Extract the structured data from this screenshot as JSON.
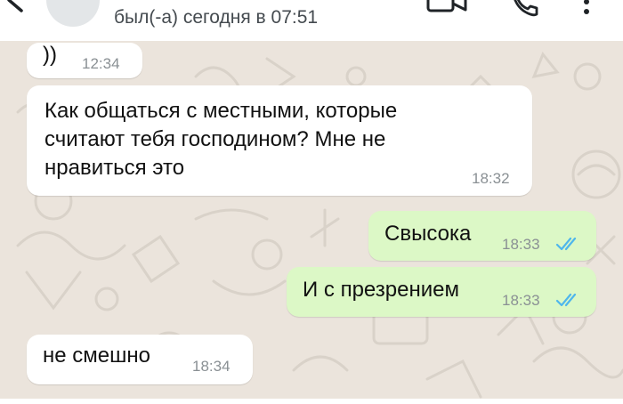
{
  "header": {
    "status": "был(-а) сегодня в 07:51"
  },
  "icons": {
    "back": "arrow-left-icon",
    "video": "video-camera-icon",
    "call": "phone-icon",
    "menu": "more-vertical-icon"
  },
  "colors": {
    "incoming_bubble": "#ffffff",
    "outgoing_bubble": "#dcf8c6",
    "read_ticks": "#4fb6ec",
    "wallpaper": "#ebe4dc"
  },
  "messages": [
    {
      "direction": "in",
      "text": "))",
      "time": "12:34"
    },
    {
      "direction": "in",
      "lines": [
        "Как общаться с местными, которые",
        "считают тебя господином? Мне не",
        "нравиться это"
      ],
      "time": "18:32"
    },
    {
      "direction": "out",
      "text": "Свысока",
      "time": "18:33",
      "status": "read"
    },
    {
      "direction": "out",
      "text": "И с презрением",
      "time": "18:33",
      "status": "read"
    },
    {
      "direction": "in",
      "text": "не смешно",
      "time": "18:34"
    }
  ]
}
